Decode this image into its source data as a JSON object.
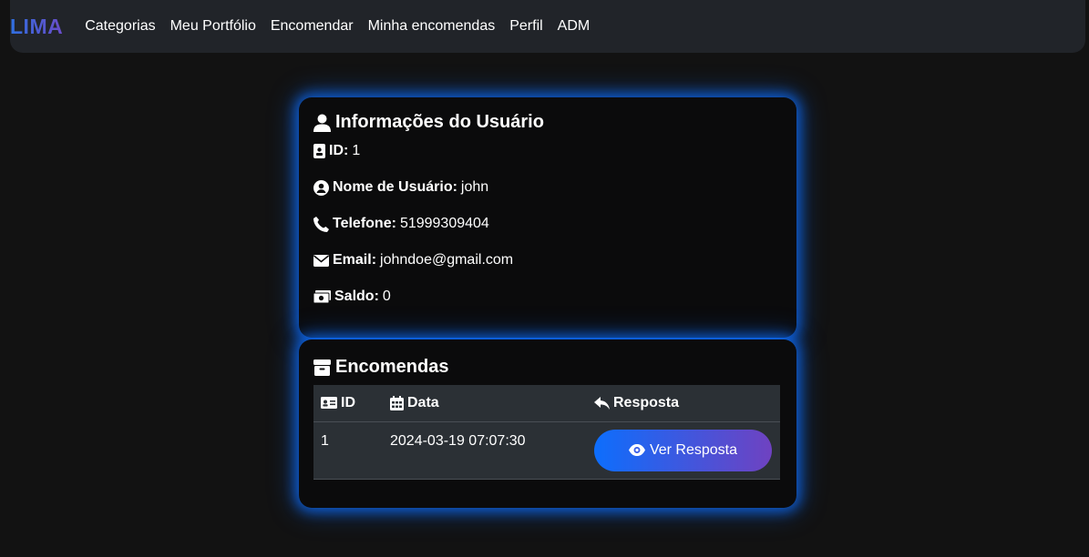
{
  "nav": {
    "brand": "LIMA",
    "links": [
      "Categorias",
      "Meu Portfólio",
      "Encomendar",
      "Minha encomendas",
      "Perfil",
      "ADM"
    ]
  },
  "user_card": {
    "title": "Informações do Usuário",
    "fields": [
      {
        "label": "ID:",
        "value": "1",
        "icon": "id-badge-icon"
      },
      {
        "label": "Nome de Usuário:",
        "value": "john",
        "icon": "user-circle-icon"
      },
      {
        "label": "Telefone:",
        "value": "51999309404",
        "icon": "phone-icon"
      },
      {
        "label": "Email:",
        "value": "johndoe@gmail.com",
        "icon": "envelope-icon"
      },
      {
        "label": "Saldo:",
        "value": "0",
        "icon": "money-bill-icon"
      }
    ]
  },
  "orders_card": {
    "title": "Encomendas",
    "columns": [
      "ID",
      "Data",
      "Resposta"
    ],
    "rows": [
      {
        "id": "1",
        "date": "2024-03-19 07:07:30",
        "action_label": "Ver Resposta"
      }
    ]
  },
  "colors": {
    "background": "#121212",
    "navbar": "#212429",
    "card": "#0b0b0c",
    "glow": "#0d6efd",
    "button_start": "#0d6efd",
    "button_end": "#6f42c1"
  }
}
